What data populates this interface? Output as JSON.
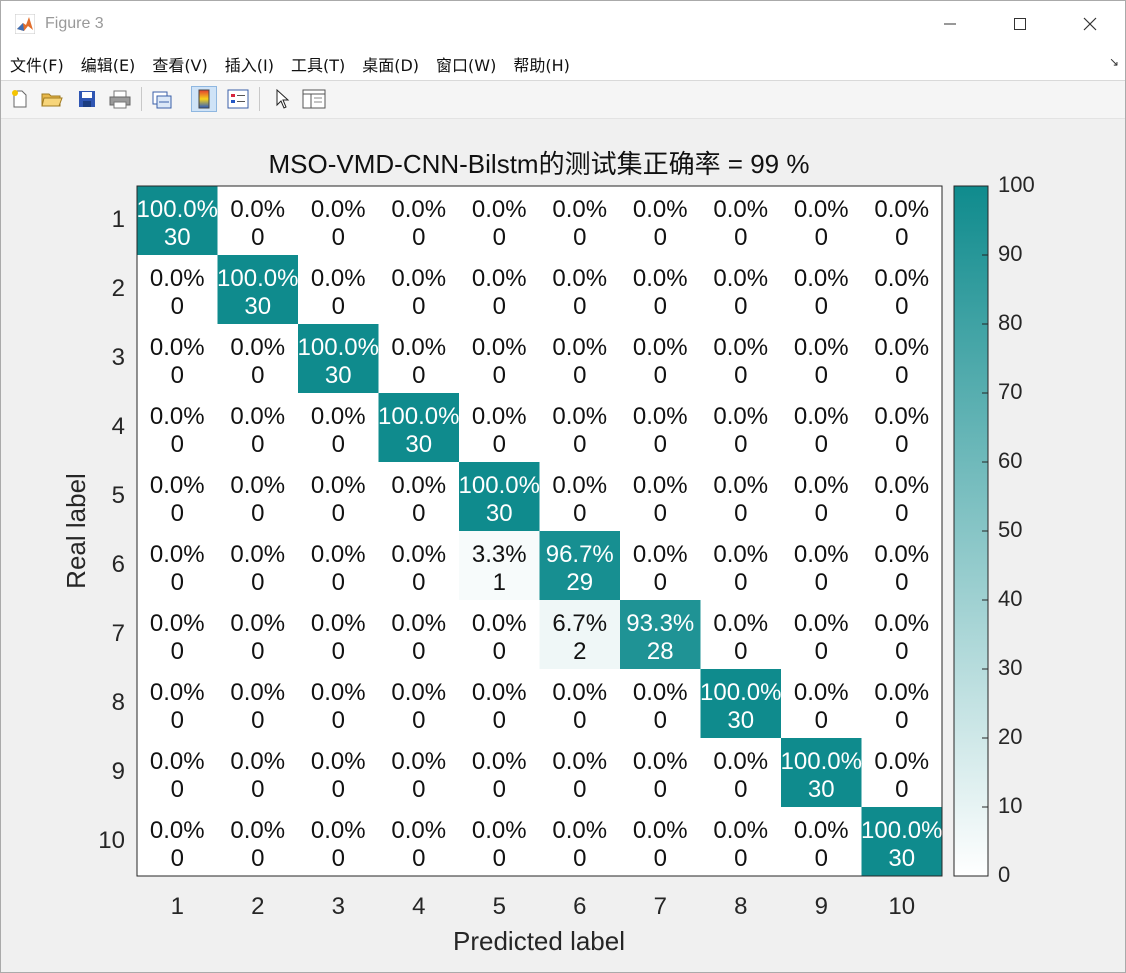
{
  "window": {
    "title": "Figure 3"
  },
  "menu": [
    "文件(F)",
    "编辑(E)",
    "查看(V)",
    "插入(I)",
    "工具(T)",
    "桌面(D)",
    "窗口(W)",
    "帮助(H)"
  ],
  "toolbar": {
    "buttons": [
      "new-figure",
      "open-file",
      "save",
      "print",
      "link-plot",
      "colorbar",
      "legend",
      "select-pointer",
      "property-inspector"
    ]
  },
  "colors": {
    "accent": "#0f8b8d",
    "low": "#ffffff"
  },
  "chart_data": {
    "type": "heatmap",
    "title": "MSO-VMD-CNN-Bilstm的测试集正确率 = 99 %",
    "xlabel": "Predicted label",
    "ylabel": "Real label",
    "x_ticks": [
      "1",
      "2",
      "3",
      "4",
      "5",
      "6",
      "7",
      "8",
      "9",
      "10"
    ],
    "y_ticks": [
      "1",
      "2",
      "3",
      "4",
      "5",
      "6",
      "7",
      "8",
      "9",
      "10"
    ],
    "percent": [
      [
        100,
        0,
        0,
        0,
        0,
        0,
        0,
        0,
        0,
        0
      ],
      [
        0,
        100,
        0,
        0,
        0,
        0,
        0,
        0,
        0,
        0
      ],
      [
        0,
        0,
        100,
        0,
        0,
        0,
        0,
        0,
        0,
        0
      ],
      [
        0,
        0,
        0,
        100,
        0,
        0,
        0,
        0,
        0,
        0
      ],
      [
        0,
        0,
        0,
        0,
        100,
        0,
        0,
        0,
        0,
        0
      ],
      [
        0,
        0,
        0,
        0,
        3.3,
        96.7,
        0,
        0,
        0,
        0
      ],
      [
        0,
        0,
        0,
        0,
        0,
        6.7,
        93.3,
        0,
        0,
        0
      ],
      [
        0,
        0,
        0,
        0,
        0,
        0,
        0,
        100,
        0,
        0
      ],
      [
        0,
        0,
        0,
        0,
        0,
        0,
        0,
        0,
        100,
        0
      ],
      [
        0,
        0,
        0,
        0,
        0,
        0,
        0,
        0,
        0,
        100
      ]
    ],
    "counts": [
      [
        30,
        0,
        0,
        0,
        0,
        0,
        0,
        0,
        0,
        0
      ],
      [
        0,
        30,
        0,
        0,
        0,
        0,
        0,
        0,
        0,
        0
      ],
      [
        0,
        0,
        30,
        0,
        0,
        0,
        0,
        0,
        0,
        0
      ],
      [
        0,
        0,
        0,
        30,
        0,
        0,
        0,
        0,
        0,
        0
      ],
      [
        0,
        0,
        0,
        0,
        30,
        0,
        0,
        0,
        0,
        0
      ],
      [
        0,
        0,
        0,
        0,
        1,
        29,
        0,
        0,
        0,
        0
      ],
      [
        0,
        0,
        0,
        0,
        0,
        2,
        28,
        0,
        0,
        0
      ],
      [
        0,
        0,
        0,
        0,
        0,
        0,
        0,
        30,
        0,
        0
      ],
      [
        0,
        0,
        0,
        0,
        0,
        0,
        0,
        0,
        30,
        0
      ],
      [
        0,
        0,
        0,
        0,
        0,
        0,
        0,
        0,
        0,
        30
      ]
    ],
    "colorbar": {
      "range": [
        0,
        100
      ],
      "ticks": [
        "0",
        "10",
        "20",
        "30",
        "40",
        "50",
        "60",
        "70",
        "80",
        "90",
        "100"
      ]
    }
  }
}
